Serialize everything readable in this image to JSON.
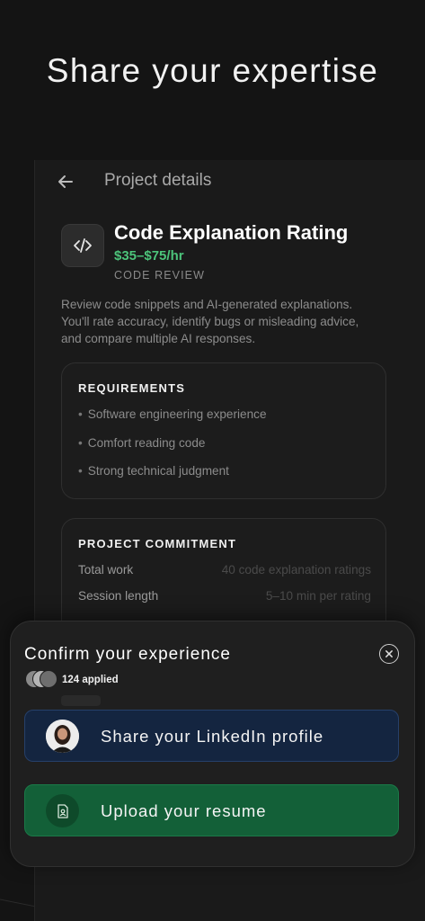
{
  "headline": "Share your expertise",
  "header": {
    "title": "Project details",
    "back_icon": "arrow-left-icon"
  },
  "project": {
    "icon": "code-icon",
    "title": "Code Explanation Rating",
    "rate": "$35–$75/hr",
    "category": "CODE REVIEW",
    "description": "Review code snippets and AI-generated explanations. You'll rate accuracy, identify bugs or misleading advice, and compare multiple AI responses.",
    "accent_color": "#4cc37a"
  },
  "requirements": {
    "title": "REQUIREMENTS",
    "items": [
      "Software engineering experience",
      "Comfort reading code",
      "Strong technical judgment"
    ]
  },
  "commitment": {
    "title": "PROJECT COMMITMENT",
    "rows": [
      {
        "label": "Total work",
        "value": "40 code explanation ratings"
      },
      {
        "label": "Session length",
        "value": "5–10 min per rating"
      }
    ]
  },
  "sheet": {
    "title": "Confirm your experience",
    "close_icon": "close-icon",
    "applied": "124 applied",
    "linkedin_button": {
      "label": "Share your LinkedIn profile",
      "color": "#142540"
    },
    "resume_button": {
      "label": "Upload your resume",
      "icon": "file-person-icon",
      "color": "#136038"
    }
  }
}
